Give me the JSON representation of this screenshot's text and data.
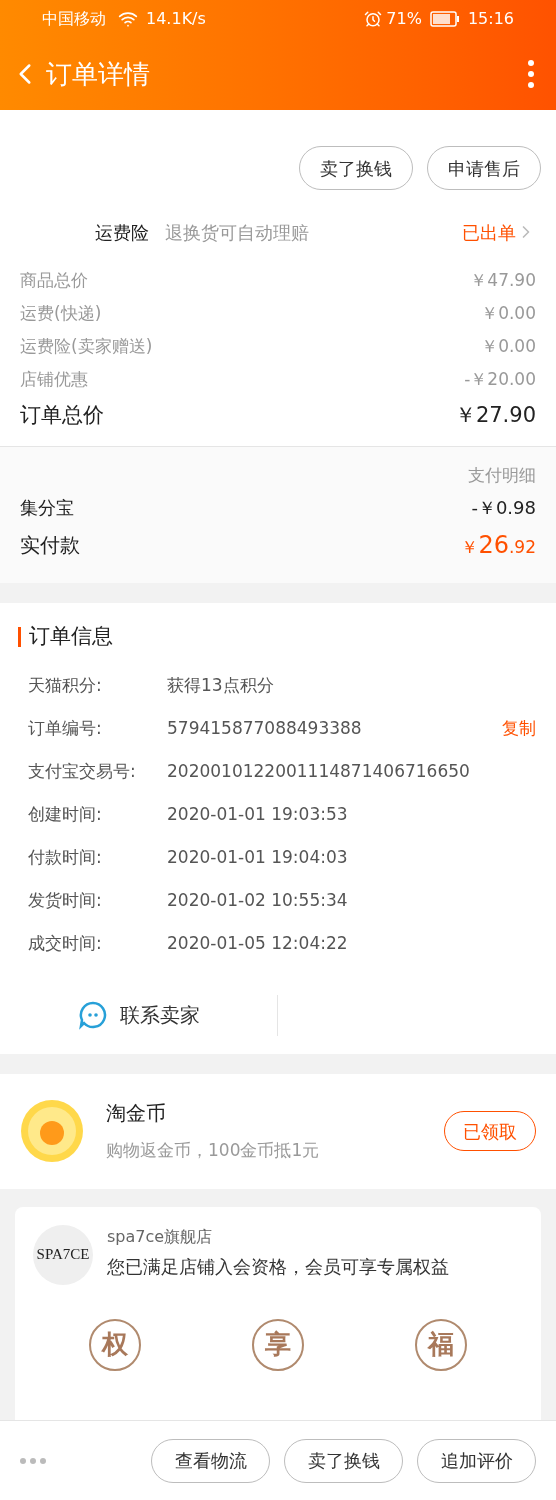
{
  "status_bar": {
    "carrier": "中国移动",
    "speed": "14.1K/s",
    "battery": "71%",
    "time": "15:16"
  },
  "header": {
    "title": "订单详情"
  },
  "actions": [
    "卖了换钱",
    "申请售后"
  ],
  "insurance": {
    "label": "运费险",
    "desc": "退换货可自动理赔",
    "status": "已出单"
  },
  "prices": [
    {
      "label": "商品总价",
      "value": "￥47.90"
    },
    {
      "label": "运费(快递)",
      "value": "￥0.00"
    },
    {
      "label": "运费险(卖家赠送)",
      "value": "￥0.00"
    },
    {
      "label": "店铺优惠",
      "value": "-￥20.00"
    }
  ],
  "total": {
    "label": "订单总价",
    "value": "￥27.90"
  },
  "payment": {
    "detail_link": "支付明细",
    "points_label": "集分宝",
    "points_value": "-￥0.98",
    "paid_label": "实付款",
    "paid_currency": "￥",
    "paid_int": "26",
    "paid_dec": ".92"
  },
  "order_info": {
    "title": "订单信息",
    "rows": [
      {
        "label": "天猫积分:",
        "value": "获得13点积分"
      },
      {
        "label": "订单编号:",
        "value": "579415877088493388",
        "action": "复制"
      },
      {
        "label": "支付宝交易号:",
        "value": "2020010122001114871406716650"
      },
      {
        "label": "创建时间:",
        "value": "2020-01-01 19:03:53"
      },
      {
        "label": "付款时间:",
        "value": "2020-01-01 19:04:03"
      },
      {
        "label": "发货时间:",
        "value": "2020-01-02 10:55:34"
      },
      {
        "label": "成交时间:",
        "value": "2020-01-05 12:04:22"
      }
    ],
    "contact": "联系卖家"
  },
  "coins": {
    "title": "淘金币",
    "desc": "购物返金币，100金币抵1元",
    "button": "已领取"
  },
  "store": {
    "logo": "SPA7CE",
    "name": "spa7ce旗舰店",
    "message": "您已满足店铺入会资格，会员可享专属权益",
    "benefits": [
      "权",
      "享",
      "福"
    ]
  },
  "bottom_bar": [
    "查看物流",
    "卖了换钱",
    "追加评价"
  ]
}
